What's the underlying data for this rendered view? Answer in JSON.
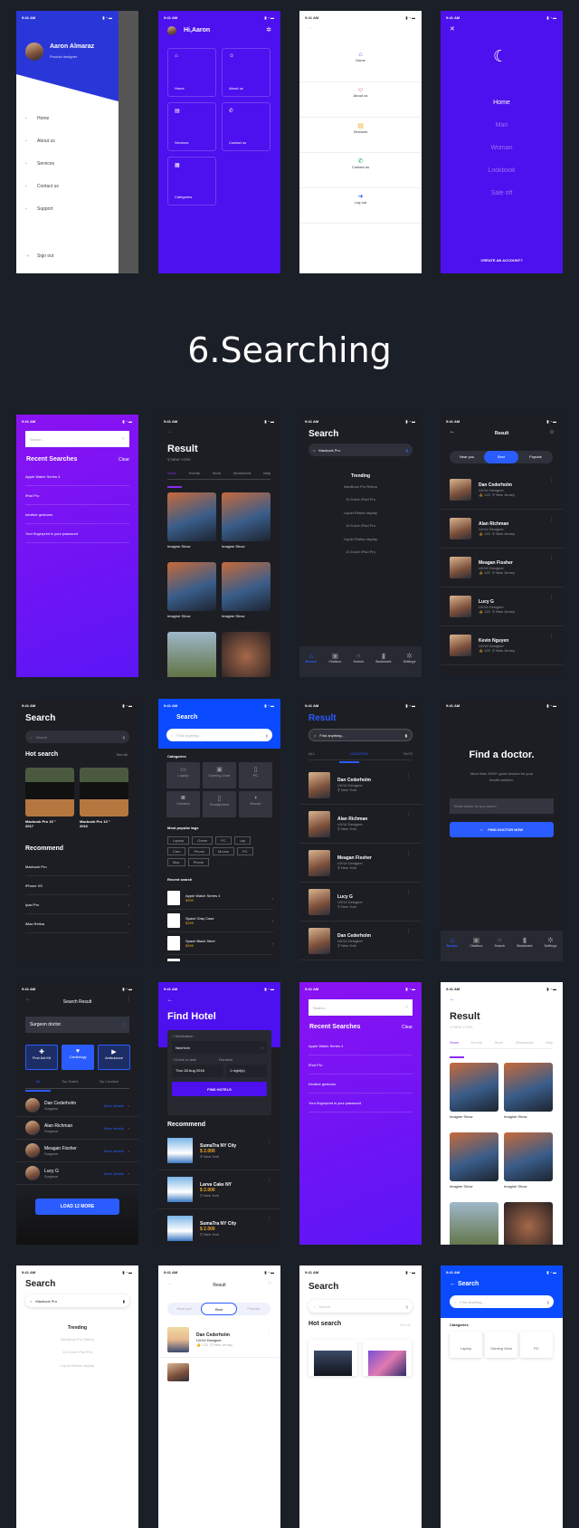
{
  "status_time": "9:41 AM",
  "section_title": "6.Searching",
  "colors": {
    "background": "#1b1f27",
    "purple": "#4d10ee",
    "blue": "#2a5cff",
    "dark": "#1f2229",
    "gradient_top": "#8b12f2",
    "gradient_bottom": "#5b16f6"
  },
  "icons": [
    "home-icon",
    "users-icon",
    "folder-icon",
    "phone-icon",
    "grid-icon",
    "gear-icon",
    "search-icon",
    "mic-icon",
    "back-arrow-icon",
    "close-icon",
    "moon-icon",
    "location-pin-icon",
    "like-icon",
    "more-icon",
    "chevron-right-icon",
    "filter-icon"
  ],
  "drawer": {
    "name": "Aaron Almaraz",
    "role": "Product designer",
    "items": [
      {
        "label": "Home"
      },
      {
        "label": "About us"
      },
      {
        "label": "Services"
      },
      {
        "label": "Contact us"
      },
      {
        "label": "Support"
      }
    ],
    "signout": "Sign out"
  },
  "tiles": {
    "greeting": "Hi,Aaron",
    "items": [
      {
        "label": "Home",
        "icon": "⌂"
      },
      {
        "label": "About us",
        "icon": "☺"
      },
      {
        "label": "Services",
        "icon": "▤"
      },
      {
        "label": "Contact us",
        "icon": "✆"
      },
      {
        "label": "Categories",
        "icon": "▦"
      }
    ]
  },
  "menu_white": {
    "items": [
      {
        "label": "Home",
        "icon": "⌂",
        "color": "#7a2cf0"
      },
      {
        "label": "About us",
        "icon": "☺",
        "color": "#f04a5a"
      },
      {
        "label": "Services",
        "icon": "▤",
        "color": "#f5a623"
      },
      {
        "label": "Contact us",
        "icon": "✆",
        "color": "#1fb65a"
      },
      {
        "label": "Log out",
        "icon": "➜",
        "color": "#2a5cff"
      }
    ]
  },
  "menu_purple": {
    "items": [
      {
        "label": "Home"
      },
      {
        "label": "Man"
      },
      {
        "label": "Woman"
      },
      {
        "label": "Lookbook"
      },
      {
        "label": "Sale off"
      }
    ],
    "cta": "CREATE AN ACCOUNT?"
  },
  "recent": {
    "placeholder": "Search...",
    "title": "Recent Searches",
    "clear": "Clear",
    "items": [
      {
        "label": "Apple Watch Series 4"
      },
      {
        "label": "iPad Pro"
      },
      {
        "label": "Intuitive gestures"
      },
      {
        "label": "Your fingerprint is your password"
      }
    ]
  },
  "result_grid": {
    "title": "Result",
    "location": "NEW YORK",
    "tabs": [
      {
        "label": "Show"
      },
      {
        "label": "Events"
      },
      {
        "label": "Store"
      },
      {
        "label": "Woodstock"
      },
      {
        "label": "Map"
      }
    ],
    "captions": [
      {
        "label": "Imagine Show"
      },
      {
        "label": "Imagine Show"
      },
      {
        "label": "Imagine Show"
      },
      {
        "label": "Imagine Show"
      }
    ]
  },
  "trending": {
    "title": "Search",
    "query": "Macbook Pro",
    "heading": "Trending",
    "items": [
      {
        "label": "MacBook Pro Retina"
      },
      {
        "label": "10.5-inch iPad Pro"
      },
      {
        "label": "Liquid Retina display"
      },
      {
        "label": "10.5-inch iPad Pro"
      },
      {
        "label": "Liquid Retina display"
      },
      {
        "label": "10.5-inch iPad Pro"
      }
    ]
  },
  "nav": [
    {
      "label": "Browse",
      "icon": "⌂"
    },
    {
      "label": "Chatbox",
      "icon": "▣"
    },
    {
      "label": "Search",
      "icon": "○"
    },
    {
      "label": "Bookmark",
      "icon": "▮"
    },
    {
      "label": "Settings",
      "icon": "✲"
    }
  ],
  "people_result": {
    "title": "Result",
    "segments": [
      {
        "label": "Near you"
      },
      {
        "label": "Best"
      },
      {
        "label": "Popular"
      }
    ],
    "role": "UX/UI Designer",
    "likes": "123",
    "location": "New Jersey",
    "people": [
      {
        "name": "Dan Cederholm"
      },
      {
        "name": "Alan Richman"
      },
      {
        "name": "Meagan Fissher"
      },
      {
        "name": "Lucy G"
      },
      {
        "name": "Kevin Nguyen"
      }
    ]
  },
  "hot": {
    "title": "Search",
    "placeholder": "Search",
    "hot_title": "Hot search",
    "see_all": "See All",
    "products": [
      {
        "name": "Macbook Pro 15 \"",
        "year": "2017"
      },
      {
        "name": "Macbook Pro 13 \"",
        "year": "2016"
      }
    ],
    "recommend": "Recommend",
    "items": [
      {
        "label": "Macbook Pro"
      },
      {
        "label": "iPhone XS"
      },
      {
        "label": "Ipad Pro"
      },
      {
        "label": "iMac Retina"
      }
    ]
  },
  "cat_search": {
    "title": "Search",
    "placeholder": "Find anything...",
    "categories": "Categories",
    "cats": [
      {
        "label": "Laptop",
        "icon": "▭"
      },
      {
        "label": "Gaming Gear",
        "icon": "▣"
      },
      {
        "label": "PC",
        "icon": "▯"
      },
      {
        "label": "Camera",
        "icon": "◙"
      },
      {
        "label": "Smartphone",
        "icon": "▯"
      },
      {
        "label": "Mouse",
        "icon": "◖"
      }
    ],
    "tags_title": "Most popular tags",
    "tags": [
      {
        "label": "Laptop"
      },
      {
        "label": "Game"
      },
      {
        "label": "PC"
      },
      {
        "label": "Lap"
      },
      {
        "label": "Cam"
      },
      {
        "label": "Phone"
      },
      {
        "label": "Mouse"
      },
      {
        "label": "PC"
      },
      {
        "label": "Mac"
      },
      {
        "label": "Phone"
      }
    ],
    "recent_title": "Recent search",
    "recent": [
      {
        "name": "Apple Watch Series 4",
        "price": "$399"
      },
      {
        "name": "Space Gray Case",
        "price": "$399"
      },
      {
        "name": "Space Black Steel",
        "price": "$399"
      },
      {
        "name": "Gold Aluminum",
        "price": ""
      }
    ]
  },
  "loc_result": {
    "title": "Result",
    "placeholder": "Find anything...",
    "tabs": [
      {
        "label": "ALL"
      },
      {
        "label": "LOCATION"
      },
      {
        "label": "TAGS"
      }
    ],
    "role": "UX/UI Designer",
    "location": "New York",
    "people": [
      {
        "name": "Dan Cederholm"
      },
      {
        "name": "Alan Richman"
      },
      {
        "name": "Meagan Fissher"
      },
      {
        "name": "Lucy G"
      },
      {
        "name": "Dan Cederholm"
      }
    ]
  },
  "doctor": {
    "title": "Find a doctor.",
    "subtitle": "More than 1000+ good doctors for your health solution.",
    "placeholder": "What doctor do you need?",
    "button": "FIND DOCTOR NOW"
  },
  "search_result": {
    "title": "Search Result",
    "query": "Surgeon doctor",
    "cats": [
      {
        "label": "First Aid Kit",
        "icon": "✚"
      },
      {
        "label": "Cardiology",
        "icon": "♥"
      },
      {
        "label": "Ambulance",
        "icon": "▶"
      }
    ],
    "tabs": [
      {
        "label": "All"
      },
      {
        "label": "Top Rated"
      },
      {
        "label": "By Location"
      }
    ],
    "role": "Surgeon",
    "link": "More details",
    "people": [
      {
        "name": "Dan Cederholm"
      },
      {
        "name": "Alan Richman"
      },
      {
        "name": "Meagan Fissher"
      },
      {
        "name": "Lucy G"
      }
    ],
    "load_more": "LOAD 12 MORE"
  },
  "hotel": {
    "title": "Find Hotel",
    "destination_label": "Destination",
    "destination": "NewYork",
    "checkin_label": "Check in date",
    "duration_label": "Duration",
    "checkin": "Thur 28 Aug 2018",
    "duration": "1 night(s)",
    "button": "FIND HOTELS",
    "recommend": "Recommend",
    "price": "$ 2.000",
    "location": "New York",
    "hotels": [
      {
        "name": "SumaTra NY City"
      },
      {
        "name": "Larva Cake NY"
      },
      {
        "name": "SumaTra NY City"
      }
    ]
  },
  "light_trending": {
    "title": "Search",
    "query": "Macbook Pro",
    "heading": "Trending",
    "items": [
      {
        "label": "MacBook Pro Retina"
      },
      {
        "label": "10.5-inch iPad Pro"
      },
      {
        "label": "Liquid Retina display"
      }
    ]
  },
  "light_result": {
    "title": "Result",
    "segments": [
      {
        "label": "Near you"
      },
      {
        "label": "Best"
      },
      {
        "label": "Popular"
      }
    ],
    "name": "Dan Cederholm",
    "role": "UX/UI Designer",
    "likes": "123",
    "location": "New Jersey"
  },
  "light_hot": {
    "title": "Search",
    "placeholder": "Search",
    "hot_title": "Hot search",
    "see_all": "See All"
  },
  "light_cat": {
    "title": "Search",
    "placeholder": "Find anything...",
    "categories": "Categories",
    "cats": [
      {
        "label": "Laptop"
      },
      {
        "label": "Gaming Gear"
      },
      {
        "label": "PC"
      }
    ]
  }
}
